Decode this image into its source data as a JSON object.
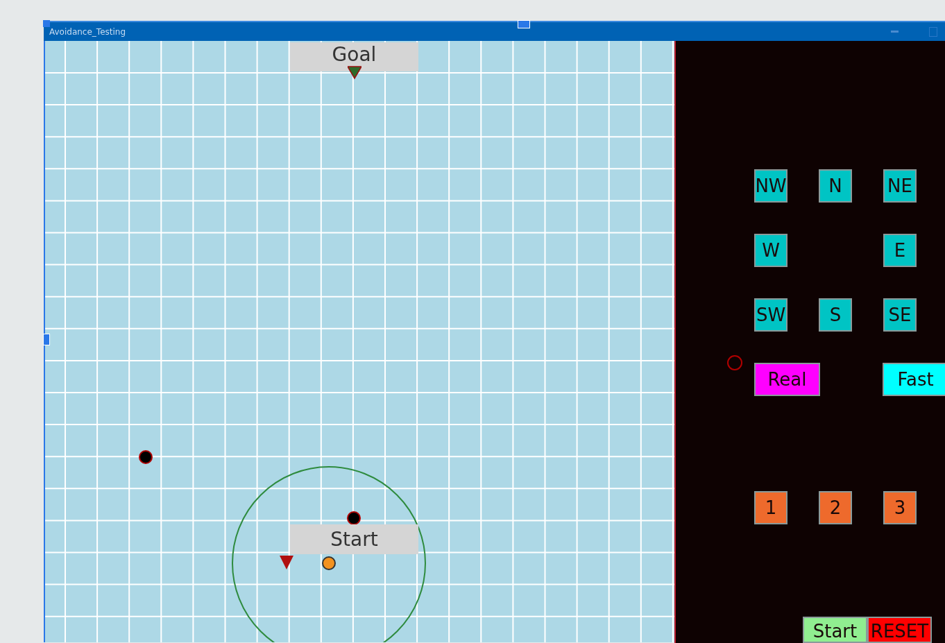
{
  "window": {
    "title": "Avoidance_Testing"
  },
  "canvas": {
    "goal_label": "Goal",
    "start_label": "Start"
  },
  "direction_rows": [
    {
      "buttons": [
        {
          "label": "NW",
          "color": "#00c4c4"
        },
        {
          "label": "N",
          "color": "#00c4c4"
        },
        {
          "label": "NE",
          "color": "#00c4c4"
        }
      ]
    },
    {
      "buttons": [
        {
          "label": "W",
          "color": "#00c4c4"
        },
        {
          "label": "E",
          "color": "#00c4c4"
        }
      ]
    },
    {
      "buttons": [
        {
          "label": "SW",
          "color": "#00c4c4"
        },
        {
          "label": "S",
          "color": "#00c4c4"
        },
        {
          "label": "SE",
          "color": "#00c4c4"
        }
      ]
    }
  ],
  "mode_buttons": [
    {
      "label": "Real",
      "color": "#ff00ff"
    },
    {
      "label": "Fast",
      "color": "#00ffff"
    }
  ],
  "number_buttons": [
    {
      "label": "1",
      "color": "#ee6a2c"
    },
    {
      "label": "2",
      "color": "#ee6a2c"
    },
    {
      "label": "3",
      "color": "#ee6a2c"
    }
  ],
  "bottom_buttons": [
    {
      "label": "Start",
      "color": "#90ee90"
    },
    {
      "label": "RESET",
      "color": "#ff0000"
    }
  ]
}
